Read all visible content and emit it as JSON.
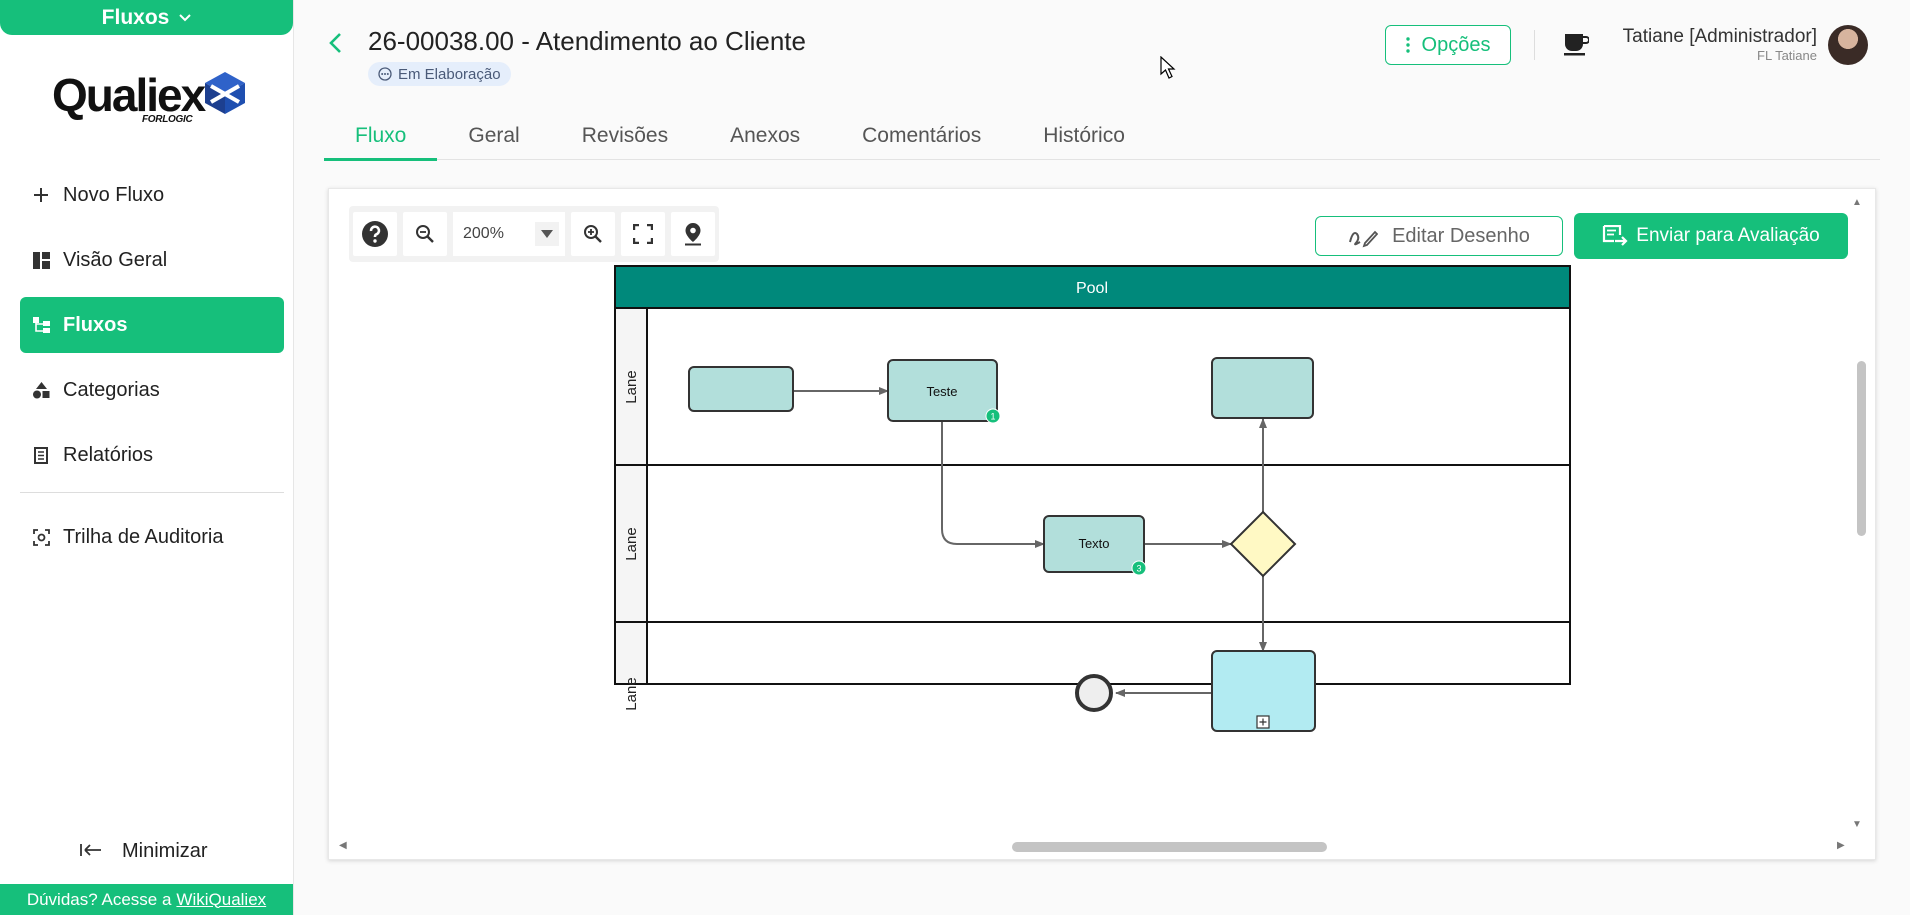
{
  "sidebar": {
    "module": "Fluxos",
    "logo_text": "Qualiex",
    "logo_sub": "FORLOGIC",
    "items": [
      {
        "label": "Novo Fluxo"
      },
      {
        "label": "Visão Geral"
      },
      {
        "label": "Fluxos"
      },
      {
        "label": "Categorias"
      },
      {
        "label": "Relatórios"
      },
      {
        "label": "Trilha de Auditoria"
      }
    ],
    "minimize": "Minimizar",
    "help_prefix": "Dúvidas? Acesse a",
    "help_link": "WikiQualiex"
  },
  "header": {
    "title": "26-00038.00 - Atendimento ao Cliente",
    "status": "Em Elaboração",
    "options": "Opções",
    "user_name": "Tatiane [Administrador]",
    "user_sub": "FL Tatiane"
  },
  "tabs": [
    {
      "label": "Fluxo"
    },
    {
      "label": "Geral"
    },
    {
      "label": "Revisões"
    },
    {
      "label": "Anexos"
    },
    {
      "label": "Comentários"
    },
    {
      "label": "Histórico"
    }
  ],
  "toolbar": {
    "zoom": "200%",
    "edit": "Editar Desenho",
    "send": "Enviar para Avaliação"
  },
  "diagram": {
    "pool": "Pool",
    "lanes": [
      "Lane",
      "Lane",
      "Lane"
    ],
    "tasks": {
      "teste": "Teste",
      "texto": "Texto",
      "teste_badge": "1",
      "texto_badge": "3"
    }
  },
  "colors": {
    "accent": "#16bf7b",
    "pool_header": "#00897b",
    "task_fill": "#b2dfdb",
    "subprocess_fill": "#b2ebf2",
    "gateway_fill": "#fff9c4"
  }
}
